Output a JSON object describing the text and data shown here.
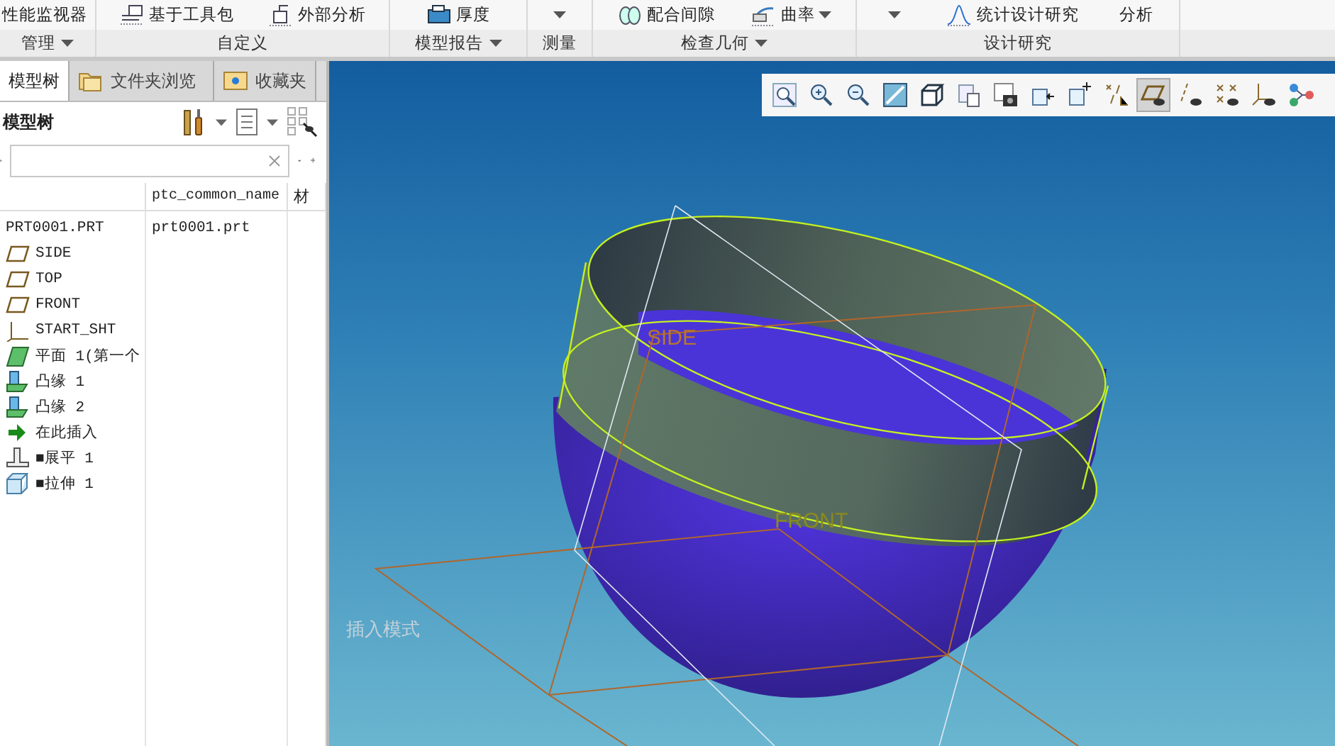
{
  "ribbon": {
    "groups": [
      {
        "label": "管理",
        "has_menu": true,
        "items": [
          {
            "kind": "text",
            "label": "性能监视器"
          }
        ]
      },
      {
        "label": "自定义",
        "has_menu": false,
        "items": [
          {
            "kind": "toolkit",
            "label": "基于工具包"
          },
          {
            "kind": "external",
            "label": "外部分析"
          }
        ]
      },
      {
        "label": "模型报告",
        "has_menu": true,
        "items": [
          {
            "kind": "thickness",
            "label": "厚度"
          }
        ]
      },
      {
        "label": "测量",
        "has_menu": false,
        "items": [
          {
            "kind": "caret"
          }
        ]
      },
      {
        "label": "检查几何",
        "has_menu": true,
        "items": [
          {
            "kind": "clearance",
            "label": "配合间隙"
          },
          {
            "kind": "curvature",
            "label": "曲率",
            "has_menu": true
          }
        ]
      },
      {
        "label": "设计研究",
        "has_menu": false,
        "items": [
          {
            "kind": "caret"
          },
          {
            "kind": "statistics",
            "label": "统计设计研究"
          },
          {
            "kind": "text",
            "label": "分析"
          }
        ]
      }
    ]
  },
  "tabs": [
    {
      "label": "模型树",
      "kind": "tree",
      "selected": true
    },
    {
      "label": "文件夹浏览",
      "kind": "folder",
      "selected": false
    },
    {
      "label": "收藏夹",
      "kind": "favorites",
      "selected": false
    }
  ],
  "model_tree": {
    "title": "模型树",
    "columns": [
      "ptc_common_name",
      "材"
    ],
    "rows": [
      {
        "label": "PRT0001.PRT",
        "common_name": "prt0001.prt",
        "children": [
          {
            "label": "SIDE",
            "kind": "datum-plane"
          },
          {
            "label": "TOP",
            "kind": "datum-plane"
          },
          {
            "label": "FRONT",
            "kind": "datum-plane"
          },
          {
            "label": "START_SHT",
            "kind": "csys"
          },
          {
            "label": "平面 1(第一个",
            "kind": "planar-wall"
          },
          {
            "label": "凸缘 1",
            "kind": "flange"
          },
          {
            "label": "凸缘 2",
            "kind": "flange"
          },
          {
            "label": "在此插入",
            "kind": "insert"
          },
          {
            "label": "■展平 1",
            "kind": "unbend"
          },
          {
            "label": "■拉伸 1",
            "kind": "extrude"
          }
        ]
      }
    ]
  },
  "view_toolbar": {
    "buttons": [
      {
        "kind": "refit",
        "selected": false
      },
      {
        "kind": "zoom-in",
        "selected": false
      },
      {
        "kind": "zoom-out",
        "selected": false
      },
      {
        "kind": "repaint",
        "selected": false
      },
      {
        "kind": "cube",
        "selected": false
      },
      {
        "kind": "views",
        "selected": false
      },
      {
        "kind": "camera",
        "selected": false
      },
      {
        "kind": "cube-left",
        "selected": false
      },
      {
        "kind": "cube-plus",
        "selected": false
      },
      {
        "kind": "datum-filter",
        "selected": false
      },
      {
        "kind": "plane-display",
        "selected": true
      },
      {
        "kind": "axis-display",
        "selected": false
      },
      {
        "kind": "point-display",
        "selected": false
      },
      {
        "kind": "csys-display",
        "selected": false
      },
      {
        "kind": "spin-center",
        "selected": false
      }
    ]
  },
  "viewport": {
    "plane_labels": [
      "SIDE",
      "FRONT"
    ],
    "mode_text": "插入模式"
  }
}
